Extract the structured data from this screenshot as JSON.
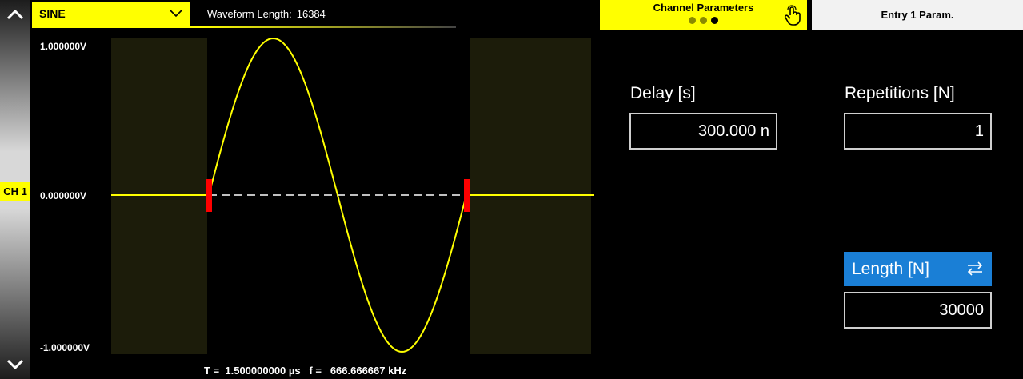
{
  "sidebar": {
    "channel_label": "CH 1"
  },
  "waveform": {
    "type_label": "SINE",
    "length_label": "Waveform Length:",
    "length_value": "16384"
  },
  "plot": {
    "y_top_label": "1.000000V",
    "y_mid_label": "0.000000V",
    "y_bottom_label": "-1.000000V",
    "info_text": "T =  1.500000000 µs   f =   666.666667 kHz",
    "colors": {
      "trace": "#ffff00",
      "marker": "#ff0000",
      "region": "#1c1c0a",
      "zero_line": "#ffffff"
    }
  },
  "tabs": {
    "channel_params": "Channel Parameters",
    "entry_params": "Entry  1  Param.",
    "page_indicator": {
      "count": 3,
      "active": 3
    }
  },
  "params": {
    "delay_label": "Delay [s]",
    "delay_value": "300.000 n",
    "repetitions_label": "Repetitions [N]",
    "repetitions_value": "1",
    "length_label": "Length [N]",
    "length_value": "30000",
    "accent": "#1a7fd6"
  },
  "icons": {
    "up": "chevron-up-icon",
    "down": "chevron-down-icon",
    "dropdown": "chevron-down-icon",
    "touch": "hand-pointer-icon",
    "swap": "swap-arrows-icon"
  }
}
